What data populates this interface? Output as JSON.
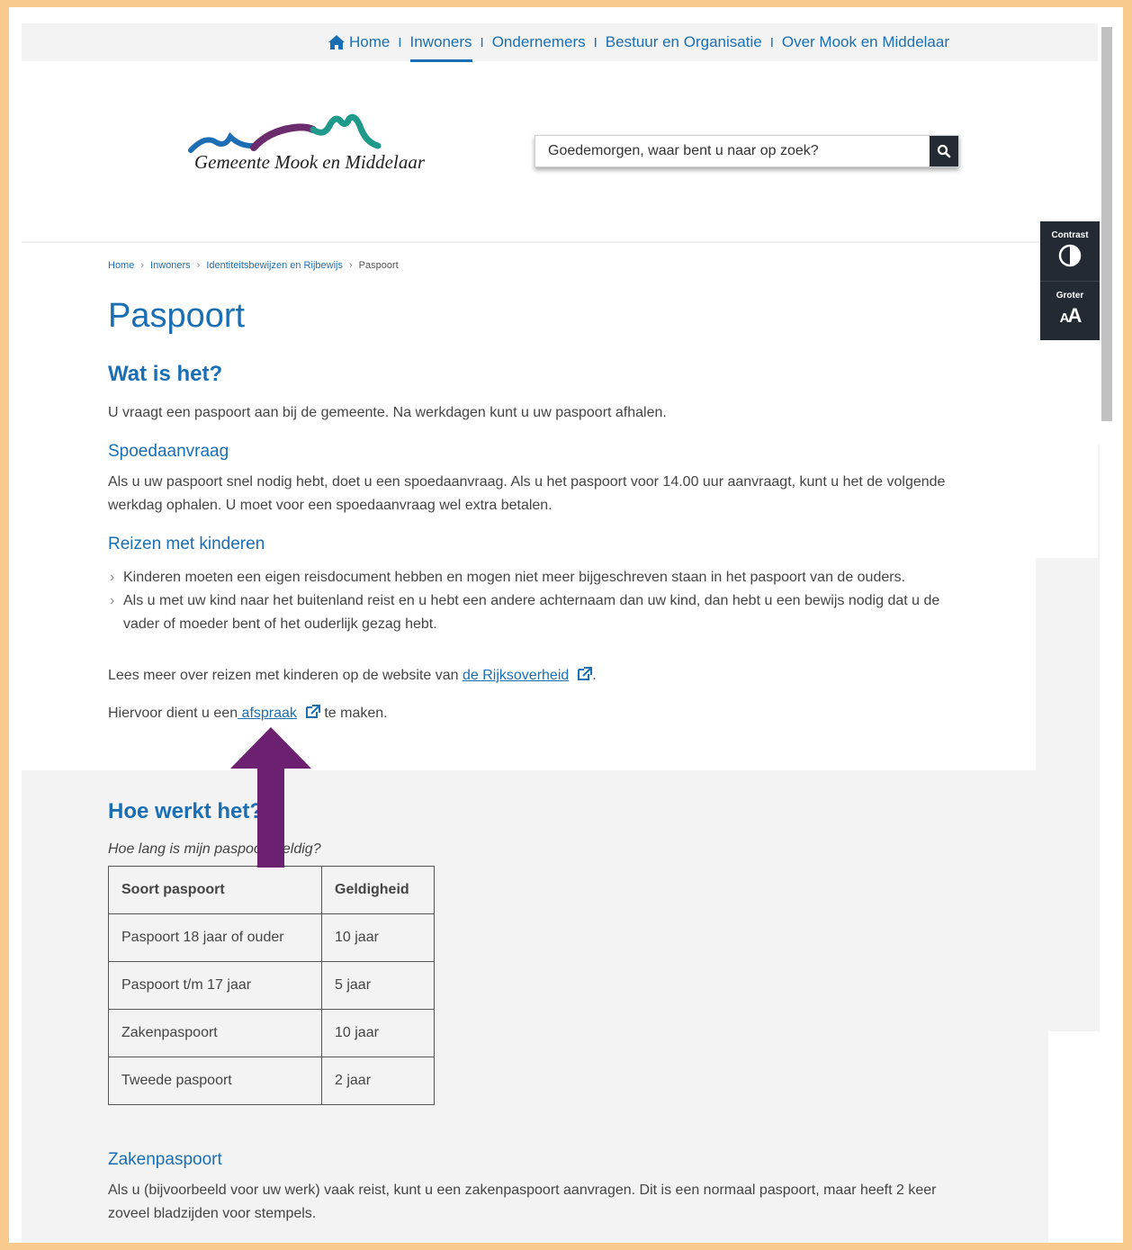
{
  "topnav": {
    "items": [
      {
        "label": "Home"
      },
      {
        "label": "Inwoners"
      },
      {
        "label": "Ondernemers"
      },
      {
        "label": "Bestuur en Organisatie"
      },
      {
        "label": "Over Mook en Middelaar"
      }
    ],
    "separator": "I"
  },
  "header": {
    "logo_text": "Gemeente Mook en Middelaar",
    "search_placeholder": "Goedemorgen, waar bent u naar op zoek?"
  },
  "a11y": {
    "contrast_label": "Contrast",
    "bigger_label": "Groter",
    "bigger_glyph_small": "A",
    "bigger_glyph_big": "A"
  },
  "breadcrumb": {
    "items": [
      "Home",
      "Inwoners",
      "Identiteitsbewijzen en Rijbewijs",
      "Paspoort"
    ]
  },
  "page": {
    "title": "Paspoort",
    "what_heading": "Wat is het?",
    "what_text": "U vraagt een paspoort aan bij de gemeente. Na werkdagen kunt u uw paspoort afhalen.",
    "urgent_heading": "Spoedaanvraag",
    "urgent_text": "Als u uw paspoort snel nodig hebt, doet u een spoedaanvraag. Als u het paspoort voor 14.00 uur aanvraagt, kunt u het de volgende werkdag ophalen. U moet voor een spoedaanvraag wel extra betalen.",
    "children_heading": "Reizen met kinderen",
    "children_bullets": [
      "Kinderen moeten een eigen reisdocument hebben en mogen niet meer bijgeschreven staan in het paspoort van de ouders.",
      "Als u met uw kind naar het buitenland reist en u hebt een andere achternaam dan uw kind, dan hebt u een bewijs nodig dat u de vader of moeder bent of het ouderlijk gezag hebt."
    ],
    "more_prefix": "Lees meer over reizen met kinderen op de website van ",
    "more_link": "de Rijksoverheid",
    "more_suffix": ".",
    "appt_prefix": "Hiervoor dient u een",
    "appt_link": " afspraak",
    "appt_suffix": " te maken.",
    "how_heading": "Hoe werkt het?",
    "validity_question": "Hoe lang is mijn paspoort geldig?",
    "table": {
      "headers": [
        "Soort paspoort",
        "Geldigheid"
      ],
      "rows": [
        [
          "Paspoort 18 jaar of ouder",
          "10 jaar"
        ],
        [
          "Paspoort t/m 17 jaar",
          "5 jaar"
        ],
        [
          "Zakenpaspoort",
          "10 jaar"
        ],
        [
          "Tweede paspoort",
          "2 jaar"
        ]
      ]
    },
    "business_heading": "Zakenpaspoort",
    "business_text": "Als u (bijvoorbeeld voor uw werk) vaak reist, kunt u een zakenpaspoort aanvragen. Dit is een normaal paspoort, maar heeft 2 keer zoveel bladzijden voor stempels."
  },
  "colors": {
    "accent": "#1a6fb4",
    "frame": "#f8ca8e",
    "dark": "#232a33",
    "arrow": "#6b2170"
  }
}
